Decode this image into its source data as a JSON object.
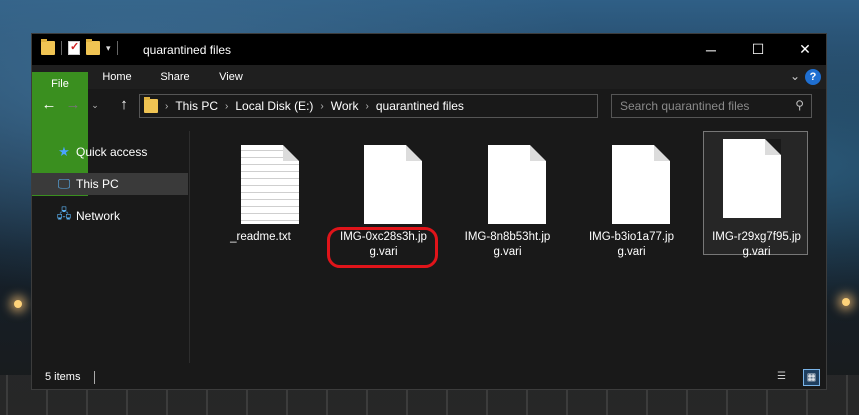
{
  "window": {
    "title": "quarantined files"
  },
  "ribbon": {
    "tabs": [
      "File",
      "Home",
      "Share",
      "View"
    ]
  },
  "address": {
    "crumbs": [
      "This PC",
      "Local Disk (E:)",
      "Work",
      "quarantined files"
    ],
    "search_placeholder": "Search quarantined files"
  },
  "nav": {
    "items": [
      {
        "label": "Quick access",
        "icon": "star-icon"
      },
      {
        "label": "This PC",
        "icon": "computer-icon"
      },
      {
        "label": "Network",
        "icon": "network-icon"
      }
    ]
  },
  "files": [
    {
      "line1": "_readme.txt",
      "line2": "",
      "type": "text"
    },
    {
      "line1": "IMG-0xc28s3h.jp",
      "line2": "g.vari",
      "type": "blank",
      "highlighted": true
    },
    {
      "line1": "IMG-8n8b53ht.jp",
      "line2": "g.vari",
      "type": "blank"
    },
    {
      "line1": "IMG-b3io1a77.jp",
      "line2": "g.vari",
      "type": "blank"
    },
    {
      "line1": "IMG-r29xg7f95.jp",
      "line2": "g.vari",
      "type": "blank",
      "selected": true
    }
  ],
  "status": {
    "count_text": "5 items"
  },
  "colors": {
    "file_tab": "#3a8f1f",
    "highlight": "#e0141a",
    "window_bg": "#191919"
  }
}
